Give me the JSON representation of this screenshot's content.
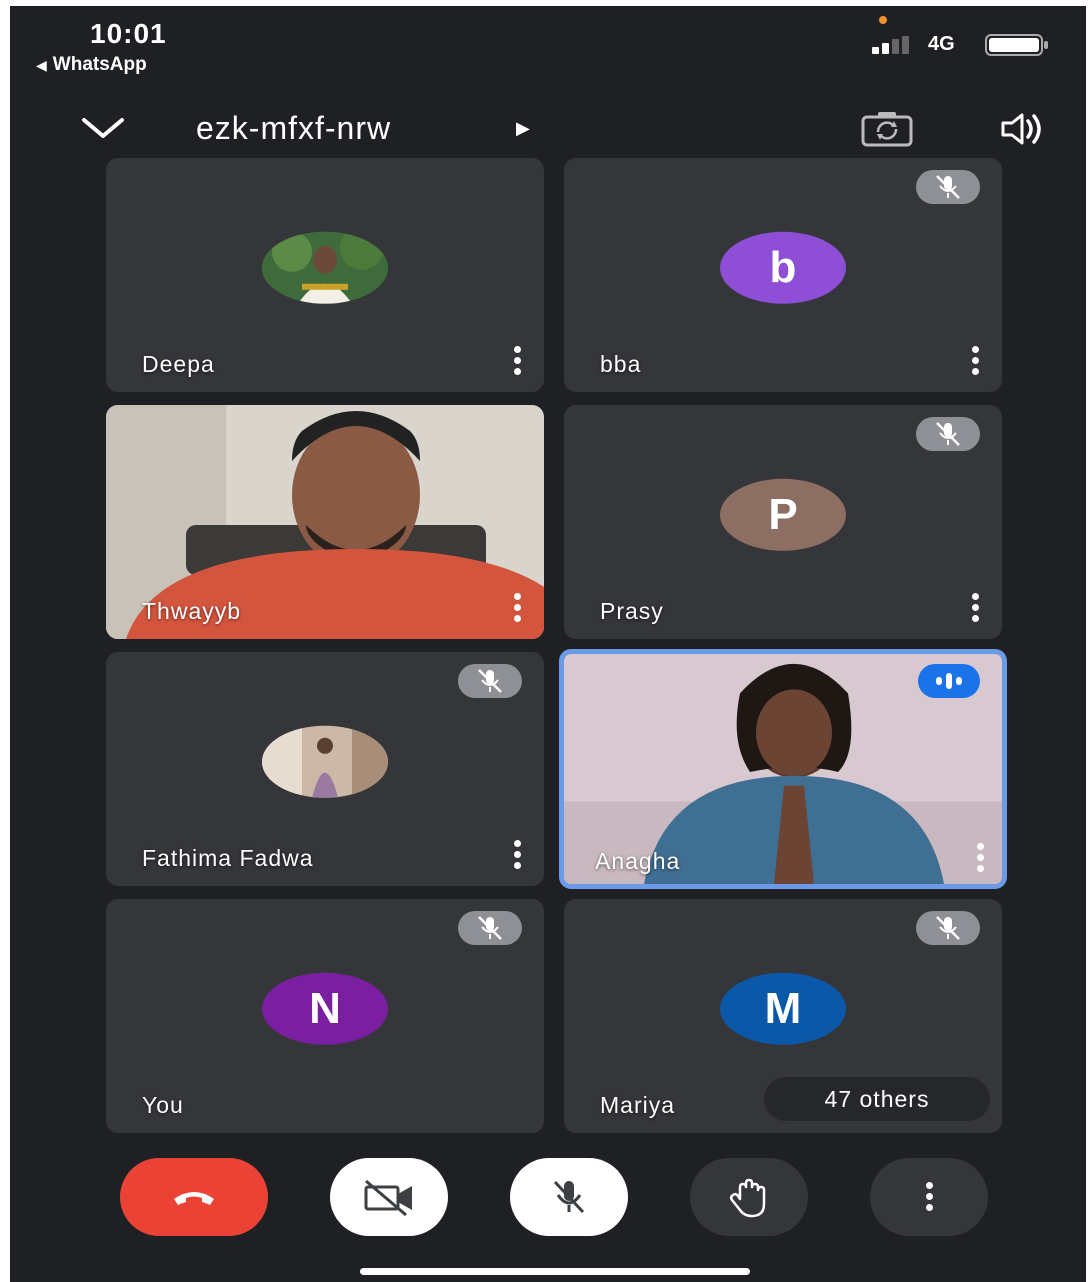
{
  "status_bar": {
    "time": "10:01",
    "back_app": "WhatsApp",
    "network": "4G",
    "signal_bars_active": 2,
    "signal_bars_total": 4
  },
  "header": {
    "meeting_code": "ezk-mfxf-nrw"
  },
  "tiles": [
    {
      "name": "Deepa",
      "avatar_letter": "",
      "muted": false,
      "speaking": false,
      "video": false
    },
    {
      "name": "bba",
      "avatar_letter": "b",
      "avatar_color": "#8e4ed6",
      "muted": true,
      "speaking": false,
      "video": false
    },
    {
      "name": "Thwayyb",
      "avatar_letter": "",
      "muted": false,
      "speaking": false,
      "video": true
    },
    {
      "name": "Prasy",
      "avatar_letter": "P",
      "avatar_color": "#8d6e63",
      "muted": true,
      "speaking": false,
      "video": false
    },
    {
      "name": "Fathima Fadwa",
      "avatar_letter": "",
      "muted": true,
      "speaking": false,
      "video": false
    },
    {
      "name": "Anagha",
      "avatar_letter": "",
      "muted": false,
      "speaking": true,
      "video": true
    },
    {
      "name": "You",
      "avatar_letter": "N",
      "avatar_color": "#7b1fa2",
      "muted": true,
      "speaking": false,
      "video": false
    },
    {
      "name": "Mariya",
      "avatar_letter": "M",
      "avatar_color": "#0b57a8",
      "muted": true,
      "speaking": false,
      "video": false
    }
  ],
  "others": {
    "label": "47 others"
  },
  "colors": {
    "end_call": "#ea4335",
    "speaking_border": "#6b9ae8",
    "speaking_badge": "#1a73e8",
    "background": "#1f2024",
    "tile": "#35363a"
  },
  "controls": {
    "icons": [
      "phone-hangup-icon",
      "video-off-icon",
      "mic-off-icon",
      "raise-hand-icon",
      "more-vert-icon"
    ]
  }
}
